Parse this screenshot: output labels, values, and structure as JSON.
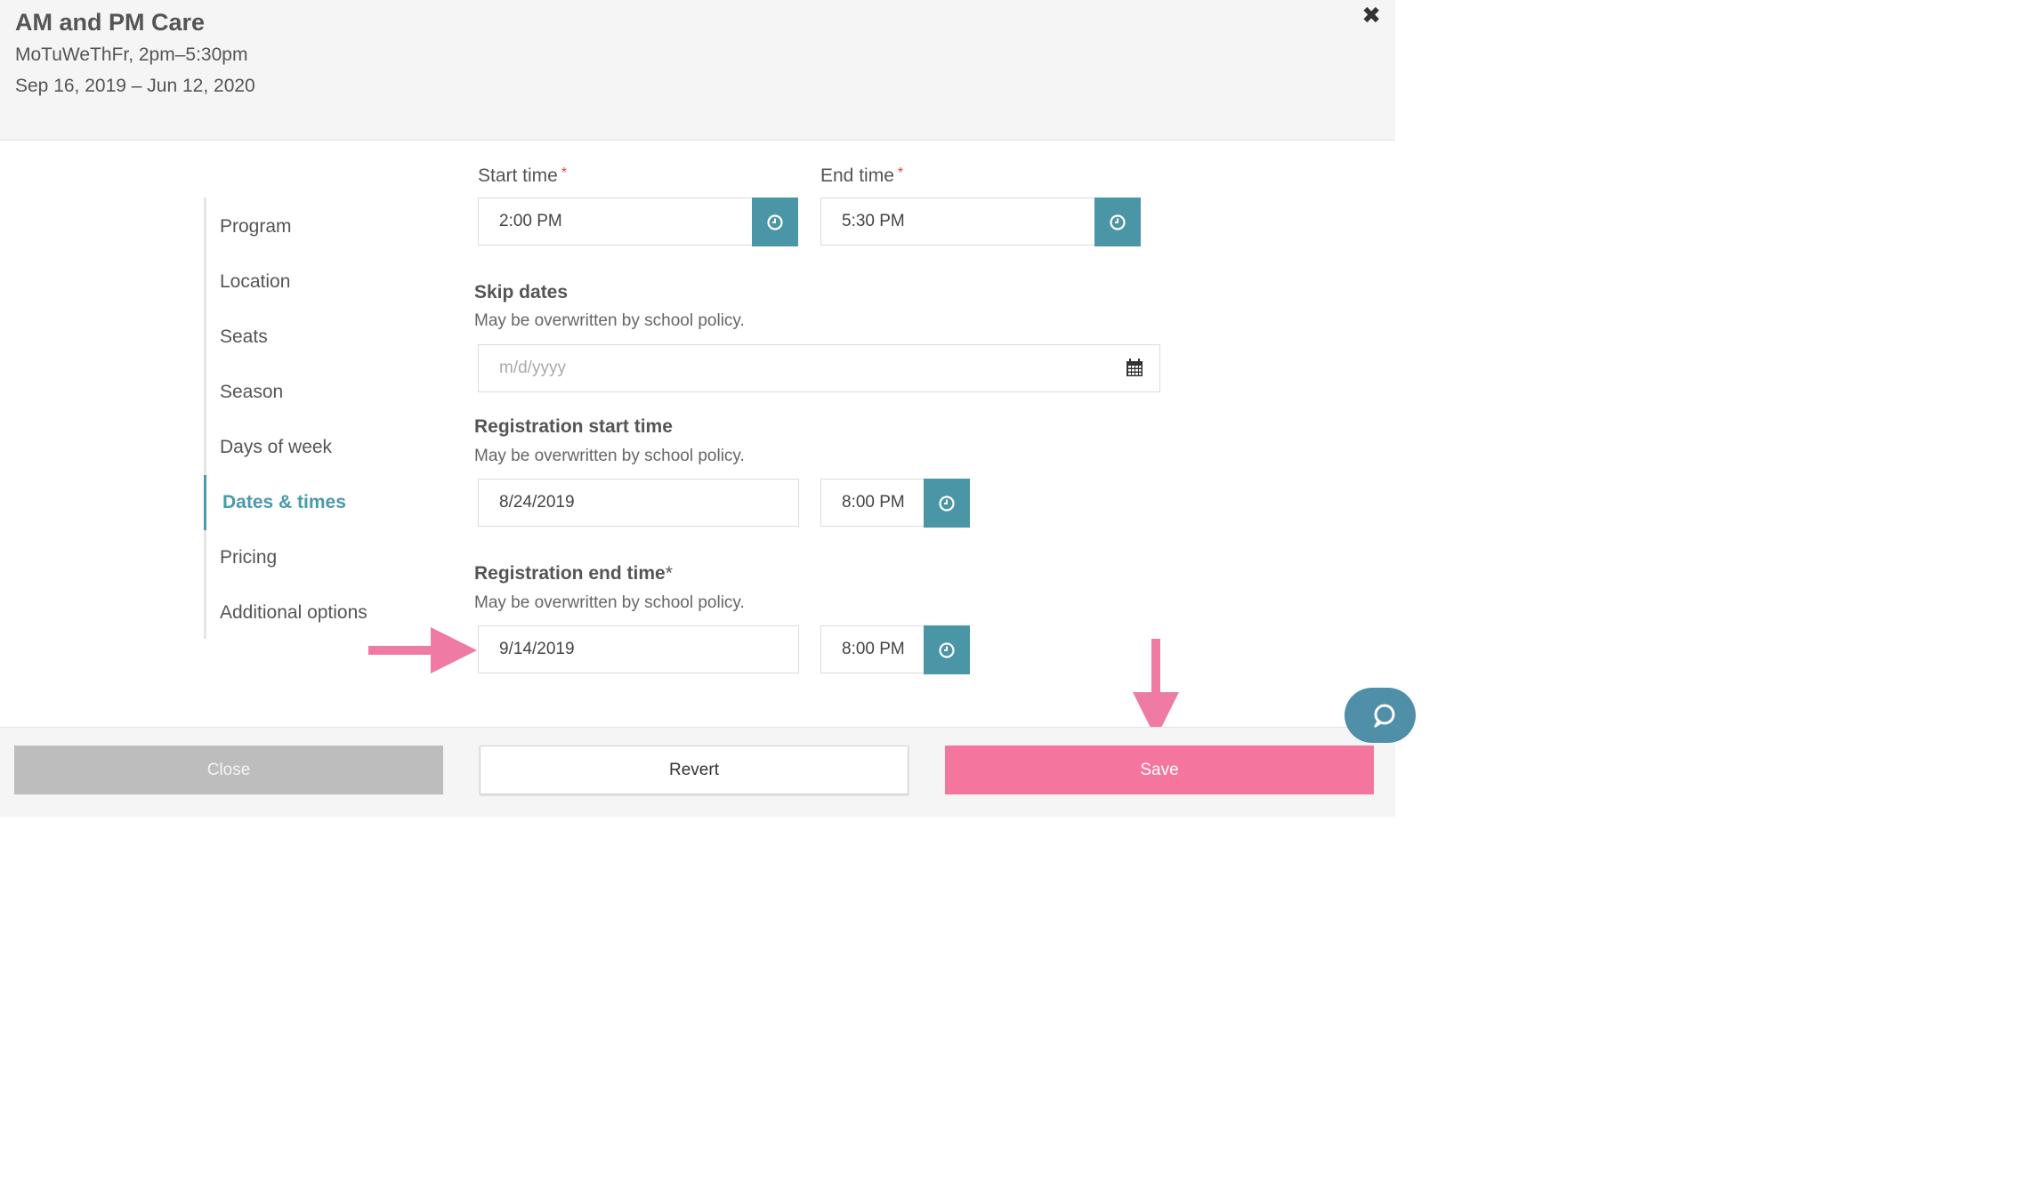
{
  "header": {
    "title": "AM and PM Care",
    "schedule": "MoTuWeThFr, 2pm–5:30pm",
    "date_range": "Sep 16, 2019 – Jun 12, 2020"
  },
  "sidebar": {
    "items": [
      {
        "label": "Program"
      },
      {
        "label": "Location"
      },
      {
        "label": "Seats"
      },
      {
        "label": "Season"
      },
      {
        "label": "Days of week"
      },
      {
        "label": "Dates & times",
        "active": true
      },
      {
        "label": "Pricing"
      },
      {
        "label": "Additional options"
      }
    ]
  },
  "form": {
    "start_time": {
      "label": "Start time",
      "required_mark": "*",
      "value": "2:00 PM"
    },
    "end_time": {
      "label": "End time",
      "required_mark": "*",
      "value": "5:30 PM"
    },
    "skip_dates": {
      "title": "Skip dates",
      "hint": "May be overwritten by school policy.",
      "placeholder": "m/d/yyyy"
    },
    "registration_start": {
      "title": "Registration start time",
      "hint": "May be overwritten by school policy.",
      "date": "8/24/2019",
      "time": "8:00 PM"
    },
    "registration_end": {
      "title": "Registration end time",
      "required_mark": "*",
      "hint": "May be overwritten by school policy.",
      "date": "9/14/2019",
      "time": "8:00 PM"
    }
  },
  "footer": {
    "close_label": "Close",
    "revert_label": "Revert",
    "save_label": "Save"
  },
  "colors": {
    "accent": "#4a96a6",
    "save": "#f4769e",
    "annotation_arrow": "#ef7aa3",
    "required": "#e0453a"
  },
  "icons": {
    "close": "close-x-icon",
    "clock": "clock-icon",
    "calendar": "calendar-icon",
    "chat": "chat-bubble-icon"
  }
}
